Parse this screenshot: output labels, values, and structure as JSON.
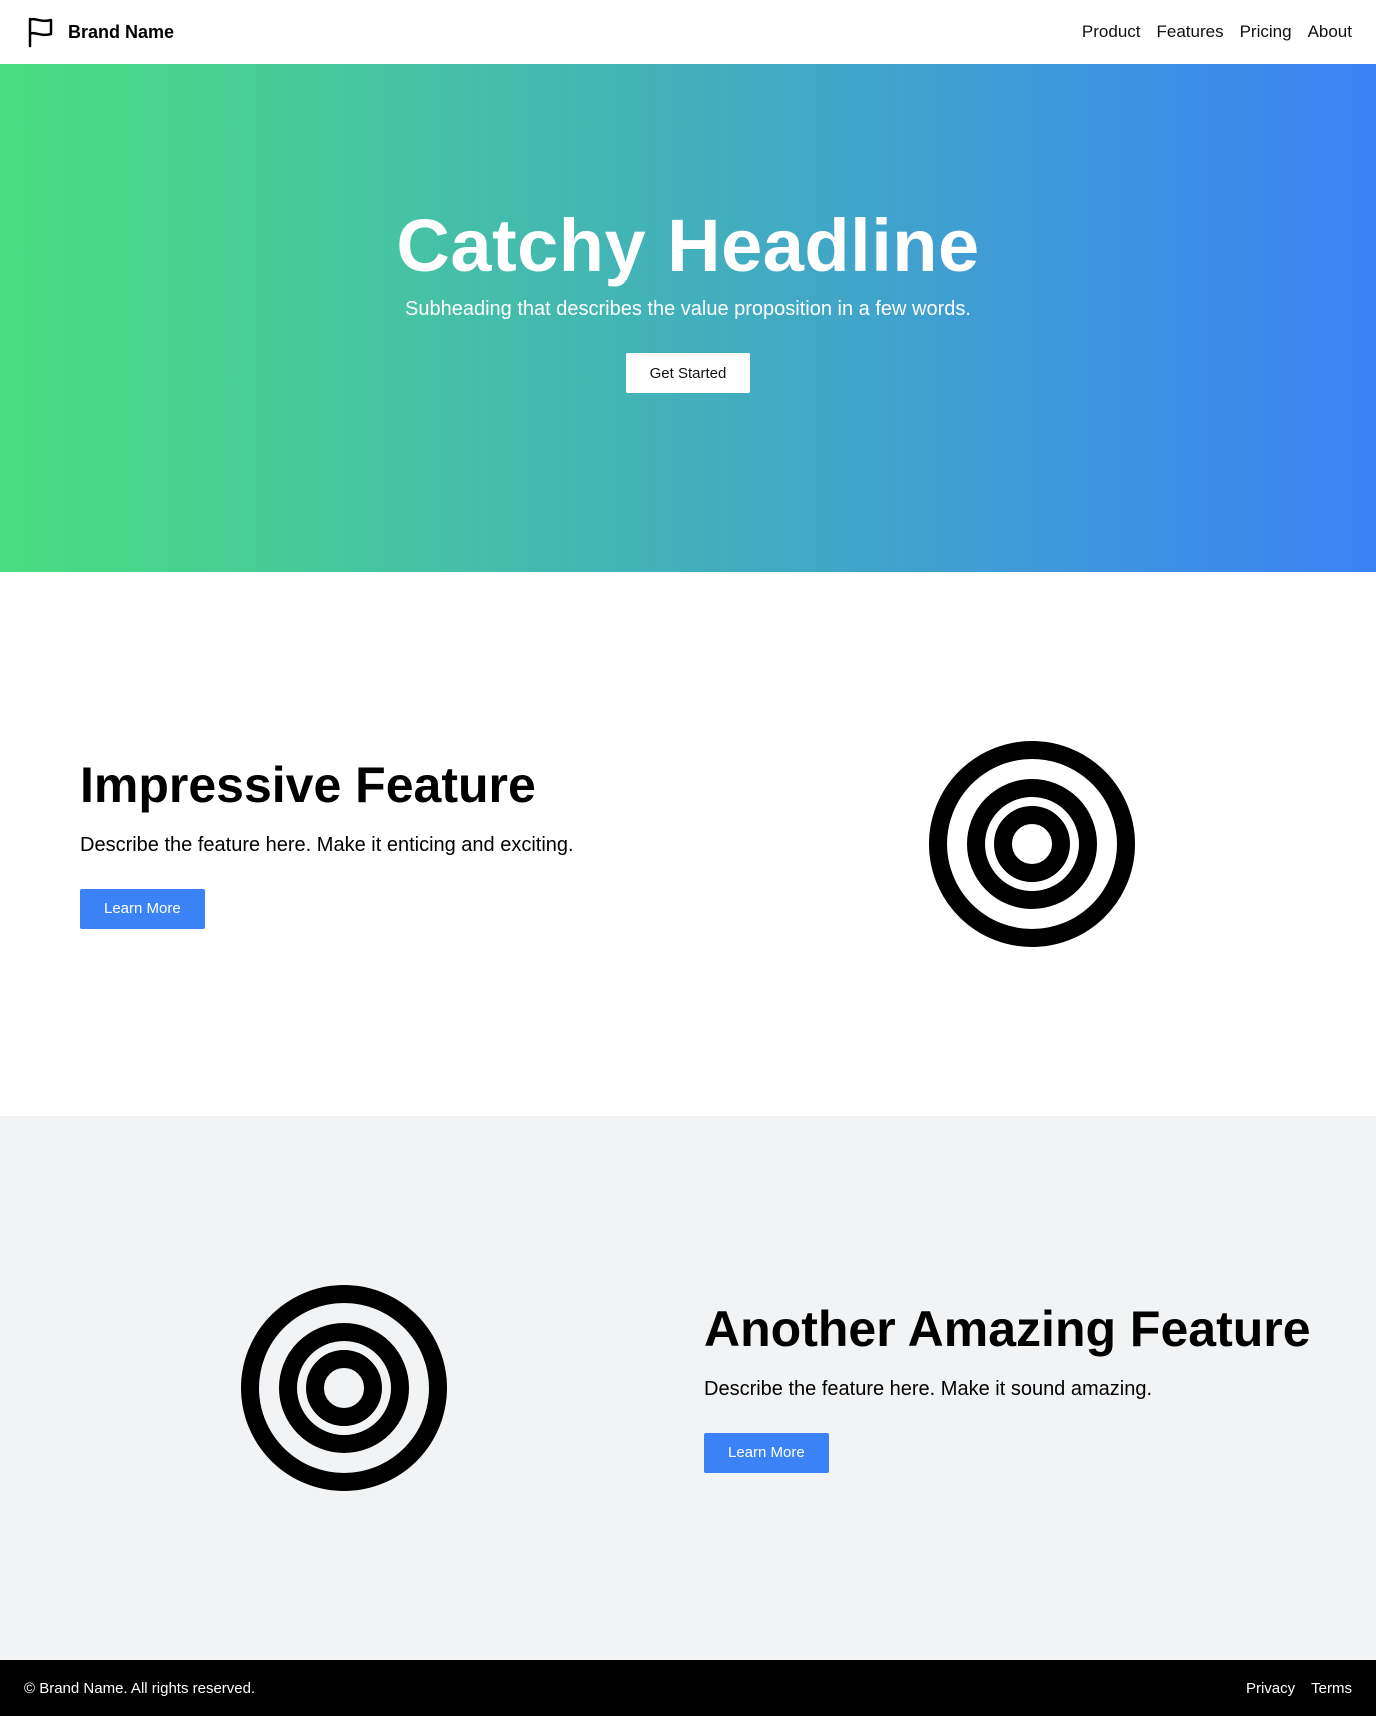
{
  "nav": {
    "brand_name": "Brand Name",
    "brand_icon": "flag-icon",
    "links": [
      "Product",
      "Features",
      "Pricing",
      "About"
    ]
  },
  "hero": {
    "title": "Catchy Headline",
    "subtitle": "Subheading that describes the value proposition in a few words.",
    "cta": "Get Started",
    "gradient_from": "#4ade80",
    "gradient_to": "#3b82f6"
  },
  "features": [
    {
      "title": "Impressive Feature",
      "description": "Describe the feature here. Make it enticing and exciting.",
      "button": "Learn More",
      "icon": "target-icon"
    },
    {
      "title": "Another Amazing Feature",
      "description": "Describe the feature here. Make it sound amazing.",
      "button": "Learn More",
      "icon": "target-icon"
    }
  ],
  "footer": {
    "copyright": "© Brand Name. All rights reserved.",
    "links": [
      "Privacy",
      "Terms"
    ]
  },
  "colors": {
    "accent": "#3b82f6",
    "section_alt_bg": "#f2f3f5",
    "footer_bg": "#000000"
  }
}
